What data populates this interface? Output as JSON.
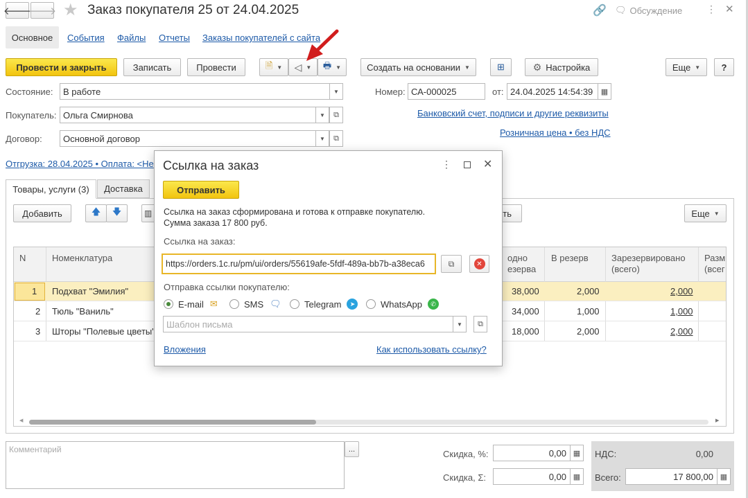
{
  "window": {
    "title": "Заказ покупателя 25 от 24.04.2025",
    "discussion": "Обсуждение"
  },
  "nav_tabs": [
    "Основное",
    "События",
    "Файлы",
    "Отчеты",
    "Заказы покупателей с сайта"
  ],
  "toolbar": {
    "post_close": "Провести и закрыть",
    "save": "Записать",
    "post": "Провести",
    "create_based": "Создать на основании",
    "settings": "Настройка",
    "more": "Еще",
    "help": "?"
  },
  "form": {
    "state_label": "Состояние:",
    "state_value": "В работе",
    "customer_label": "Покупатель:",
    "customer_value": "Ольга Смирнова",
    "contract_label": "Договор:",
    "contract_value": "Основной договор",
    "number_label": "Номер:",
    "number_value": "СА-000025",
    "date_label": "от:",
    "date_value": "24.04.2025 14:54:39",
    "bank_link": "Банковский счет, подписи и другие реквизиты",
    "price_link": "Розничная цена • без НДС",
    "shipment_link": "Отгрузка: 28.04.2025 • Оплата: <Не"
  },
  "doc_tabs": {
    "goods": "Товары, услуги (3)",
    "delivery": "Доставка"
  },
  "table_toolbar": {
    "add": "Добавить",
    "more": "Еще",
    "partial_text": "ть"
  },
  "table": {
    "headers": {
      "n": "N",
      "item": "Номенклатура",
      "free": "одно\nезерва",
      "reserve": "В резерв",
      "reserved": "Зарезервировано\n(всего)",
      "size": "Разм\n(всег"
    },
    "rows": [
      {
        "n": "1",
        "item": "Подхват \"Эмилия\"",
        "free": "38,000",
        "reserve": "2,000",
        "reserved": "2,000"
      },
      {
        "n": "2",
        "item": "Тюль \"Ваниль\"",
        "free": "34,000",
        "reserve": "1,000",
        "reserved": "1,000"
      },
      {
        "n": "3",
        "item": "Шторы \"Полевые цветы\"",
        "free": "18,000",
        "reserve": "2,000",
        "reserved": "2,000"
      }
    ]
  },
  "footer": {
    "comment_placeholder": "Комментарий",
    "discount_pct_label": "Скидка, %:",
    "discount_pct_value": "0,00",
    "discount_sum_label": "Скидка, Σ:",
    "discount_sum_value": "0,00",
    "vat_label": "НДС:",
    "vat_value": "0,00",
    "total_label": "Всего:",
    "total_value": "17 800,00"
  },
  "dialog": {
    "title": "Ссылка на заказ",
    "send": "Отправить",
    "message_line1": "Ссылка на заказ сформирована и готова к отправке покупателю.",
    "message_line2": "Сумма заказа 17 800 руб.",
    "link_label": "Ссылка на заказ:",
    "link_value": "https://orders.1c.ru/pm/ui/orders/55619afe-5fdf-489a-bb7b-a38eca6",
    "send_label": "Отправка ссылки покупателю:",
    "channels": [
      "E-mail",
      "SMS",
      "Telegram",
      "WhatsApp"
    ],
    "template_placeholder": "Шаблон письма",
    "attachments": "Вложения",
    "how_to": "Как использовать ссылку?"
  },
  "colors": {
    "accent_yellow": "#f5d21c",
    "link_blue": "#1d5aa8",
    "arrow_red": "#d11d1d",
    "row_selected": "#fbefc0"
  }
}
